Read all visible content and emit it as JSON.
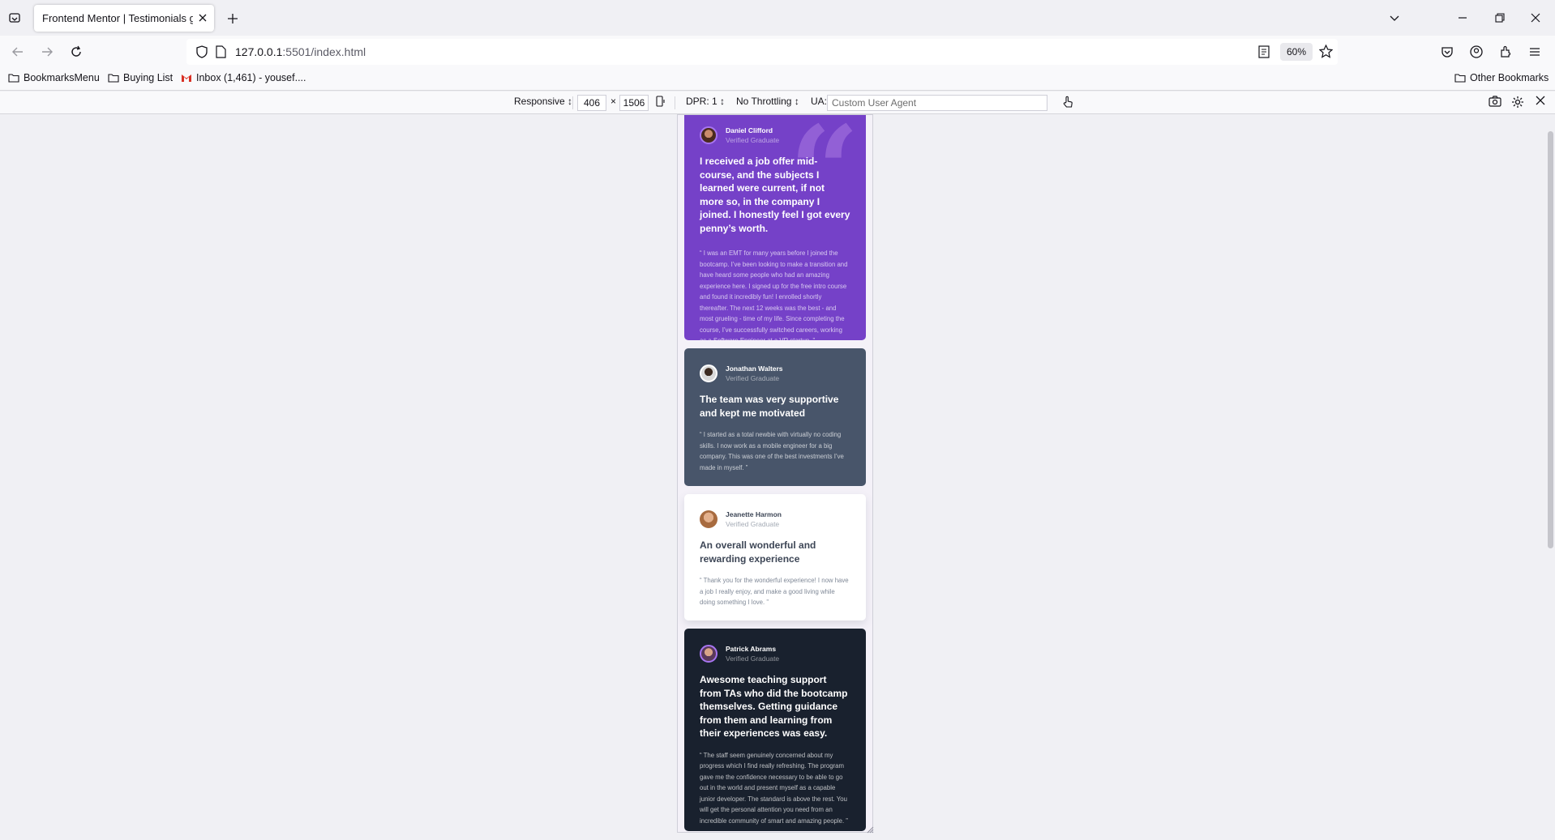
{
  "browser": {
    "tab_title": "Frontend Mentor | Testimonials grid section",
    "url_host": "127.0.0.1",
    "url_rest": ":5501/index.html",
    "zoom": "60%"
  },
  "bookmarks": [
    {
      "label": "BookmarksMenu",
      "icon": "folder-icon"
    },
    {
      "label": "Buying List",
      "icon": "folder-icon"
    },
    {
      "label": "Inbox (1,461) - yousef....",
      "icon": "gmail-icon"
    }
  ],
  "other_bookmarks": "Other Bookmarks",
  "rdm": {
    "device": "Responsive ↕",
    "width": "406",
    "times": "×",
    "height": "1506",
    "dpr": "DPR: 1 ↕",
    "throttling": "No Throttling ↕",
    "ua_label": "UA:",
    "ua_placeholder": "Custom User Agent"
  },
  "testimonials": [
    {
      "name": "Daniel Clifford",
      "role": "Verified Graduate",
      "headline": "I received a job offer mid-course, and the subjects I learned were current, if not more so, in the company I joined. I honestly feel I got every penny’s worth.",
      "body": "“ I was an EMT for many years before I joined the bootcamp. I’ve been looking to make a transition and have heard some people who had an amazing experience here. I signed up for the free intro course and found it incredibly fun! I enrolled shortly thereafter. The next 12 weeks was the best - and most grueling - time of my life. Since completing the course, I’ve successfully switched careers, working as a Software Engineer at a VR startup. ”"
    },
    {
      "name": "Jonathan Walters",
      "role": "Verified Graduate",
      "headline": "The team was very supportive and kept me motivated",
      "body": "“ I started as a total newbie with virtually no coding skills. I now work as a mobile engineer for a big company. This was one of the best investments I’ve made in myself. ”"
    },
    {
      "name": "Jeanette Harmon",
      "role": "Verified Graduate",
      "headline": "An overall wonderful and rewarding experience",
      "body": "“ Thank you for the wonderful experience! I now have a job I really enjoy, and make a good living while doing something I love. ”"
    },
    {
      "name": "Patrick Abrams",
      "role": "Verified Graduate",
      "headline": "Awesome teaching support from TAs who did the bootcamp themselves. Getting guidance from them and learning from their experiences was easy.",
      "body": "“ The staff seem genuinely concerned about my progress which I find really refreshing. The program gave me the confidence necessary to be able to go out in the world and present myself as a capable junior developer. The standard is above the rest. You will get the personal attention you need from an incredible community of smart and amazing people. ”"
    }
  ],
  "colors": {
    "purple": "#7541c8",
    "grey_blue": "#48556a",
    "white": "#ffffff",
    "dark_blue": "#19212e"
  }
}
